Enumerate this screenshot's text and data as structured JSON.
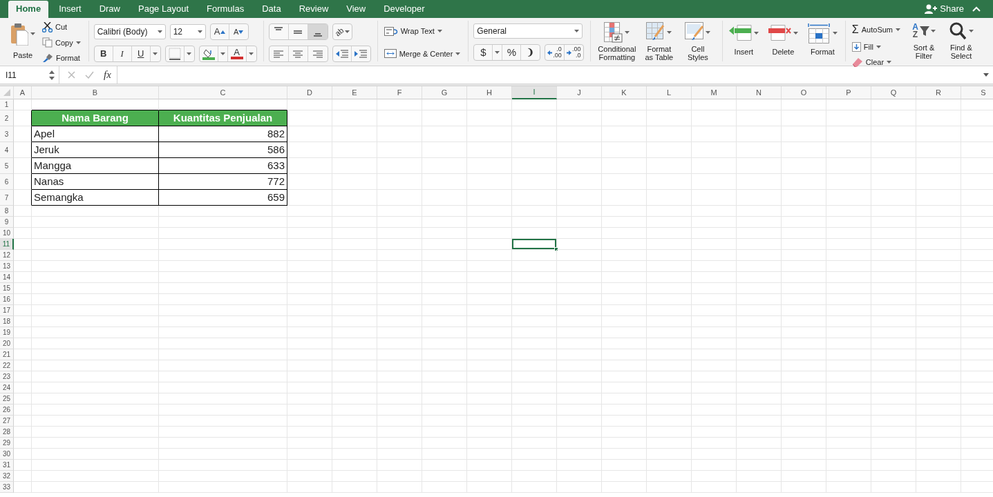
{
  "tabs": [
    {
      "label": "Home",
      "selected": true
    },
    {
      "label": "Insert",
      "selected": false
    },
    {
      "label": "Draw",
      "selected": false
    },
    {
      "label": "Page Layout",
      "selected": false
    },
    {
      "label": "Formulas",
      "selected": false
    },
    {
      "label": "Data",
      "selected": false
    },
    {
      "label": "Review",
      "selected": false
    },
    {
      "label": "View",
      "selected": false
    },
    {
      "label": "Developer",
      "selected": false
    }
  ],
  "share": "Share",
  "clipboard": {
    "paste": "Paste",
    "cut": "Cut",
    "copy": "Copy",
    "format": "Format"
  },
  "font": {
    "name": "Calibri (Body)",
    "size": "12",
    "grow": "A",
    "shrink": "A",
    "bold": "B",
    "italic": "I",
    "underline": "U",
    "font_color": "A"
  },
  "vertical_align": [
    {
      "kind": "top",
      "selected": false
    },
    {
      "kind": "middle",
      "selected": false
    },
    {
      "kind": "bottom",
      "selected": true
    }
  ],
  "orientation": "ab",
  "alignment": {
    "wrap_text": "Wrap Text",
    "merge_center": "Merge & Center"
  },
  "number": {
    "format": "General",
    "currency": "$",
    "percent": "%",
    "comma": "❩",
    "increase_decimal": [
      ".0",
      ".00"
    ],
    "decrease_decimal": [
      ".00",
      ".0"
    ]
  },
  "styles": [
    {
      "kind": "conditional",
      "label": "Conditional Formatting"
    },
    {
      "kind": "table",
      "label": "Format as Table"
    },
    {
      "kind": "cell",
      "label": "Cell Styles"
    }
  ],
  "cells": [
    {
      "kind": "insert",
      "label": "Insert"
    },
    {
      "kind": "delete",
      "label": "Delete"
    },
    {
      "kind": "format",
      "label": "Format"
    }
  ],
  "editing": {
    "autosum_symbol": "Σ",
    "autosum": "AutoSum",
    "fill": "Fill",
    "clear": "Clear",
    "sort_letters": [
      "A",
      "Z"
    ],
    "sort_filter": "Sort & Filter",
    "find_select": "Find & Select"
  },
  "name_box": "I11",
  "function_label": "fx",
  "columns": [
    {
      "label": "A",
      "selected": false
    },
    {
      "label": "B",
      "selected": false
    },
    {
      "label": "C",
      "selected": false
    },
    {
      "label": "D",
      "selected": false
    },
    {
      "label": "E",
      "selected": false
    },
    {
      "label": "F",
      "selected": false
    },
    {
      "label": "G",
      "selected": false
    },
    {
      "label": "H",
      "selected": false
    },
    {
      "label": "I",
      "selected": true
    },
    {
      "label": "J",
      "selected": false
    },
    {
      "label": "K",
      "selected": false
    },
    {
      "label": "L",
      "selected": false
    },
    {
      "label": "M",
      "selected": false
    },
    {
      "label": "N",
      "selected": false
    },
    {
      "label": "O",
      "selected": false
    },
    {
      "label": "P",
      "selected": false
    },
    {
      "label": "Q",
      "selected": false
    },
    {
      "label": "R",
      "selected": false
    },
    {
      "label": "S",
      "selected": false
    }
  ],
  "rows": [
    {
      "label": "1",
      "selected": false
    },
    {
      "label": "2",
      "selected": false
    },
    {
      "label": "3",
      "selected": false
    },
    {
      "label": "4",
      "selected": false
    },
    {
      "label": "5",
      "selected": false
    },
    {
      "label": "6",
      "selected": false
    },
    {
      "label": "7",
      "selected": false
    },
    {
      "label": "8",
      "selected": false
    },
    {
      "label": "9",
      "selected": false
    },
    {
      "label": "10",
      "selected": false
    },
    {
      "label": "11",
      "selected": true
    },
    {
      "label": "12",
      "selected": false
    },
    {
      "label": "13",
      "selected": false
    },
    {
      "label": "14",
      "selected": false
    },
    {
      "label": "15",
      "selected": false
    },
    {
      "label": "16",
      "selected": false
    },
    {
      "label": "17",
      "selected": false
    },
    {
      "label": "18",
      "selected": false
    },
    {
      "label": "19",
      "selected": false
    },
    {
      "label": "20",
      "selected": false
    },
    {
      "label": "21",
      "selected": false
    },
    {
      "label": "22",
      "selected": false
    },
    {
      "label": "23",
      "selected": false
    },
    {
      "label": "24",
      "selected": false
    },
    {
      "label": "25",
      "selected": false
    },
    {
      "label": "26",
      "selected": false
    },
    {
      "label": "27",
      "selected": false
    },
    {
      "label": "28",
      "selected": false
    },
    {
      "label": "29",
      "selected": false
    },
    {
      "label": "30",
      "selected": false
    },
    {
      "label": "31",
      "selected": false
    },
    {
      "label": "32",
      "selected": false
    },
    {
      "label": "33",
      "selected": false
    }
  ],
  "table": {
    "header": [
      "Nama Barang",
      "Kuantitas Penjualan"
    ],
    "rows": [
      [
        "Apel",
        "882"
      ],
      [
        "Jeruk",
        "586"
      ],
      [
        "Mangga",
        "633"
      ],
      [
        "Nanas",
        "772"
      ],
      [
        "Semangka",
        "659"
      ]
    ]
  }
}
